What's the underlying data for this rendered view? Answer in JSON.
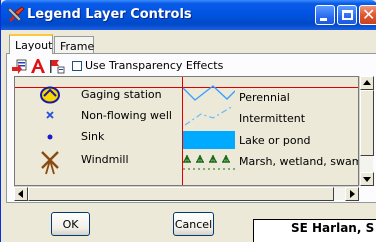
{
  "window": {
    "title": "Legend Layer Controls",
    "icon": "tool-icon"
  },
  "tabs": [
    {
      "label": "Layout",
      "active": true
    },
    {
      "label": "Frame",
      "active": false
    }
  ],
  "toolbar": {
    "icons": [
      "add-layer-icon",
      "text-style-icon",
      "flag-options-icon"
    ],
    "checkbox_label": "Use Transparency Effects",
    "checkbox_checked": false
  },
  "legend": {
    "left_items": [
      {
        "symbol": "gaging-station-icon",
        "label": "Gaging station"
      },
      {
        "symbol": "x-mark-icon",
        "label": "Non-flowing well"
      },
      {
        "symbol": "dot-icon",
        "label": "Sink"
      },
      {
        "symbol": "windmill-icon",
        "label": "Windmill"
      }
    ],
    "right_items": [
      {
        "symbol": "perennial-line",
        "label": "Perennial"
      },
      {
        "symbol": "intermittent-line",
        "label": "Intermittent"
      },
      {
        "symbol": "lake-fill",
        "label": "Lake or pond"
      },
      {
        "symbol": "marsh-pattern",
        "label": "Marsh, wetland, swamp"
      }
    ]
  },
  "buttons": {
    "ok": "OK",
    "cancel": "Cancel"
  },
  "map_fragment": {
    "text": "SE Harlan, S"
  },
  "colors": {
    "title_bar": "#0054e3",
    "divider_red": "#e00000",
    "water_blue": "#00aaff"
  }
}
